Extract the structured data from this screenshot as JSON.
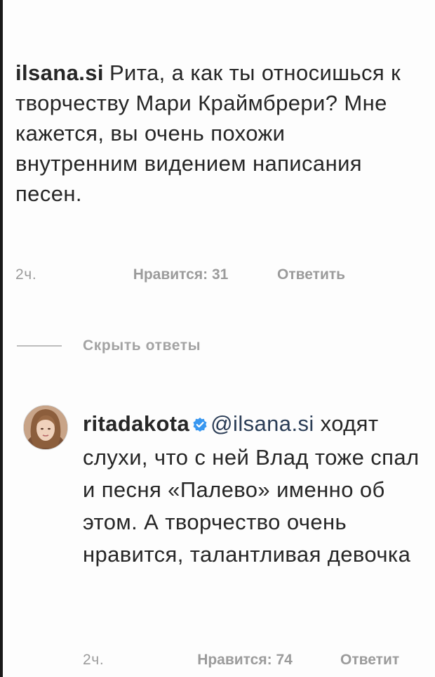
{
  "comment": {
    "username": "ilsana.si",
    "text": "Рита, а как ты относишься к творчеству Мари Краймбрери? Мне кажется, вы очень похожи внутренним видением написания песен.",
    "time": "2ч.",
    "likes": "Нравится: 31",
    "reply_label": "Ответить"
  },
  "replies_toggle": {
    "label": "Скрыть ответы"
  },
  "reply": {
    "username": "ritadakota",
    "verified_icon": "verified-badge-icon",
    "verified_color": "#3897f0",
    "mention": "@ilsana.si",
    "text": "ходят слухи, что с ней Влад тоже спал и песня «Палево» именно об этом. А творчество очень нравится, талантливая девочка",
    "time": "2ч.",
    "likes": "Нравится: 74",
    "reply_label": "Ответит"
  }
}
